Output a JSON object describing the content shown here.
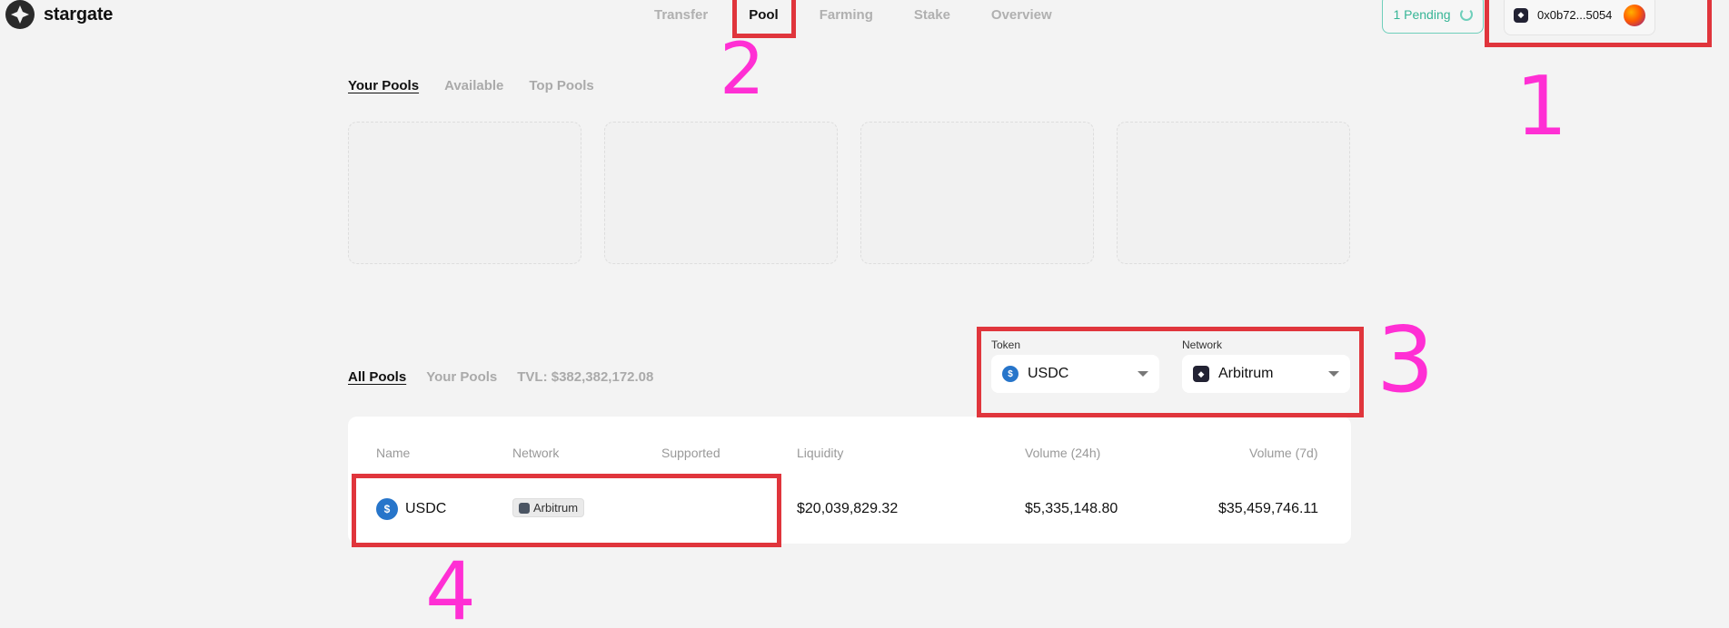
{
  "brand": {
    "name": "stargate"
  },
  "nav": {
    "items": [
      {
        "label": "Transfer"
      },
      {
        "label": "Pool"
      },
      {
        "label": "Farming"
      },
      {
        "label": "Stake"
      },
      {
        "label": "Overview"
      }
    ]
  },
  "header": {
    "pending_label": "1 Pending",
    "wallet_address": "0x0b72...5054"
  },
  "pools_section": {
    "tabs": [
      "Your Pools",
      "Available",
      "Top Pools"
    ]
  },
  "all_pools_section": {
    "tabs": [
      "All Pools",
      "Your Pools"
    ],
    "tvl_label": "TVL: $382,382,172.08"
  },
  "filters": {
    "token": {
      "label": "Token",
      "value": "USDC"
    },
    "network": {
      "label": "Network",
      "value": "Arbitrum"
    }
  },
  "table": {
    "headers": [
      "Name",
      "Network",
      "Supported",
      "Liquidity",
      "Volume (24h)",
      "Volume (7d)"
    ],
    "rows": [
      {
        "name": "USDC",
        "network": "Arbitrum",
        "liquidity": "$20,039,829.32",
        "volume_24h": "$5,335,148.80",
        "volume_7d": "$35,459,746.11"
      }
    ]
  },
  "annotations": [
    "1",
    "2",
    "3",
    "4"
  ],
  "colors": {
    "highlight_box": "#e0353c",
    "annotation_ink": "#ff2fd4",
    "pending_accent": "#37b596",
    "usdc_blue": "#2775ca"
  }
}
